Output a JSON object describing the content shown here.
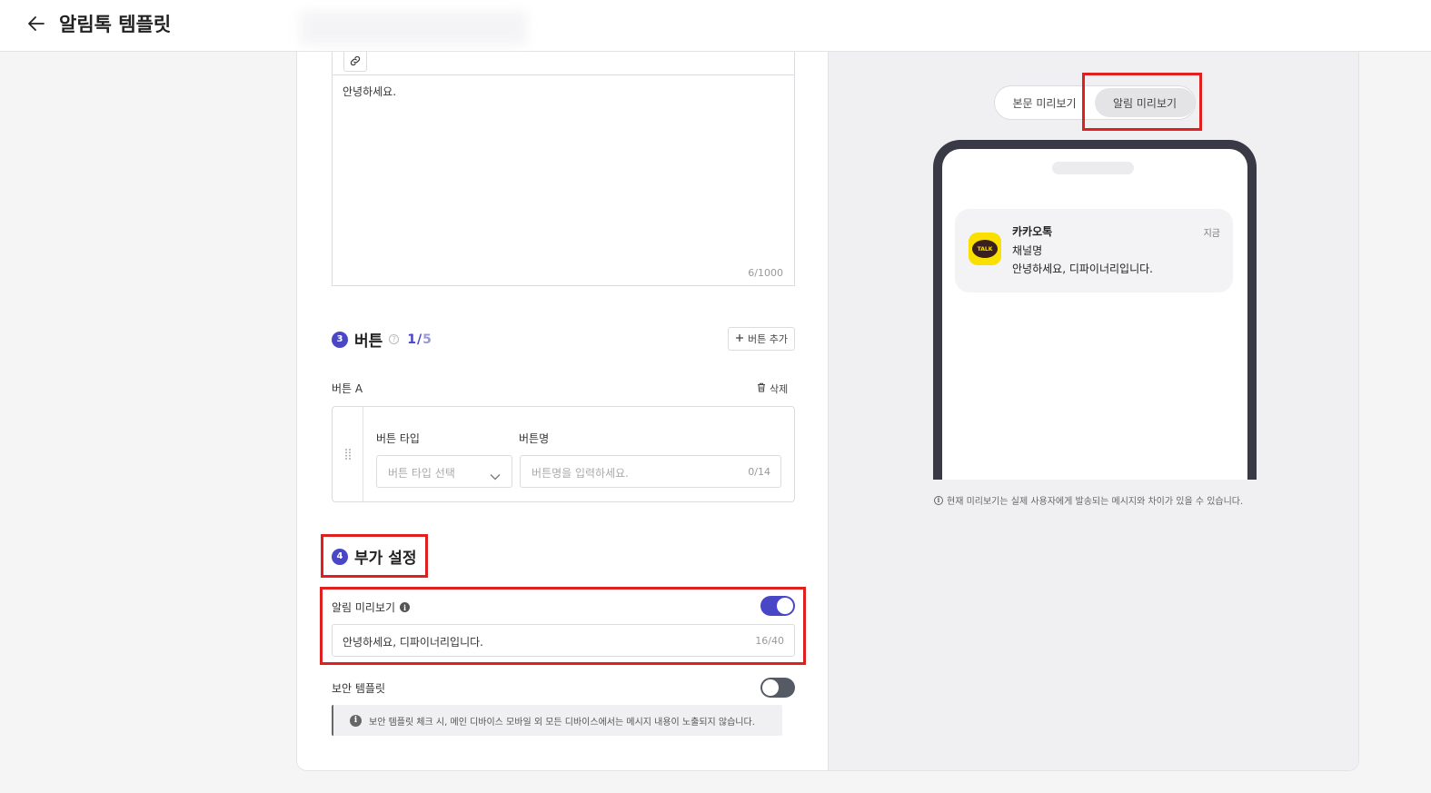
{
  "header": {
    "title": "알림톡 템플릿"
  },
  "editor": {
    "content": "안녕하세요.",
    "char_count": "6/1000"
  },
  "buttons_section": {
    "step": "3",
    "title": "버튼",
    "help": "?",
    "count_current": "1",
    "count_sep": "/",
    "count_max": "5",
    "add_button_label": "버튼 추가",
    "button_a": {
      "label": "버튼 A",
      "delete_label": "삭제",
      "type_label": "버튼 타입",
      "type_placeholder": "버튼 타입 선택",
      "name_label": "버튼명",
      "name_placeholder": "버튼명을 입력하세요.",
      "name_count": "0/14"
    }
  },
  "extra_section": {
    "step": "4",
    "title": "부가 설정",
    "notification_preview": {
      "label": "알림 미리보기",
      "info": "i",
      "enabled": true,
      "value": "안녕하세요, 디파이너리입니다.",
      "count": "16/40"
    },
    "secure_template": {
      "label": "보안 템플릿",
      "enabled": false,
      "notice": "보안 템플릿 체크 시, 메인 디바이스 모바일 외 모든 디바이스에서는 메시지 내용이 노출되지 않습니다."
    }
  },
  "preview": {
    "tabs": [
      "본문 미리보기",
      "알림 미리보기"
    ],
    "active_tab": "알림 미리보기",
    "notification": {
      "logo_text": "TALK",
      "app_name": "카카오톡",
      "time": "지금",
      "channel": "채널명",
      "message": "안녕하세요, 디파이너리입니다."
    },
    "disclaimer": "현재 미리보기는 실제 사용자에게 발송되는 메시지와 차이가 있을 수 있습니다."
  },
  "colors": {
    "accent": "#4a47c6",
    "highlight": "#e0201f",
    "kakao_yellow": "#f9e000",
    "phone_frame": "#3a3a46"
  },
  "icons": [
    "back-arrow-icon",
    "link-icon",
    "plus-icon",
    "trash-icon",
    "drag-handle-icon",
    "chevron-down-icon",
    "info-icon",
    "help-icon",
    "kakao-talk-icon"
  ]
}
